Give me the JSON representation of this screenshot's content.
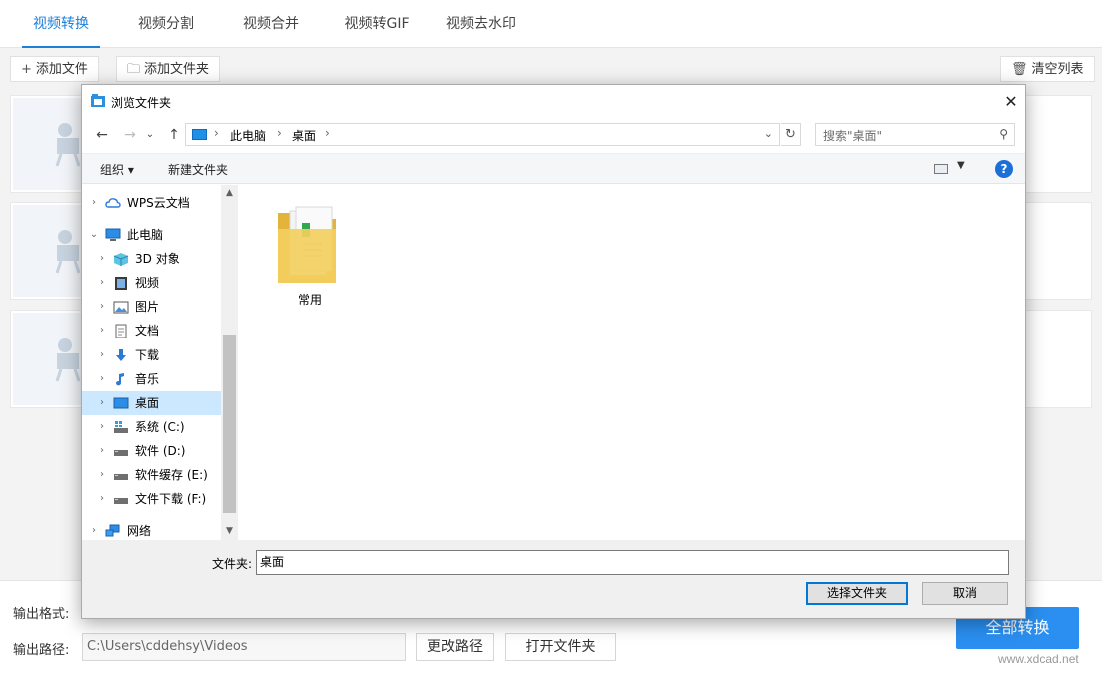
{
  "app": {
    "tabs": [
      "视频转换",
      "视频分割",
      "视频合并",
      "视频转GIF",
      "视频去水印"
    ],
    "active_tab": 0,
    "toolbar": {
      "add_file": "添加文件",
      "add_folder": "添加文件夹",
      "clear_list": "清空列表"
    },
    "bottom": {
      "output_format_label": "输出格式:",
      "output_path_label": "输出路径:",
      "output_path_value": "C:\\Users\\cddehsy\\Videos",
      "change_path": "更改路径",
      "open_folder": "打开文件夹",
      "convert_all": "全部转换"
    },
    "watermark": "www.xdcad.net",
    "accent_color": "#1d7fd8"
  },
  "dialog": {
    "title": "浏览文件夹",
    "breadcrumb": [
      "此电脑",
      "桌面"
    ],
    "search_placeholder": "搜索\"桌面\"",
    "commands": {
      "organize": "组织 ▾",
      "new_folder": "新建文件夹"
    },
    "tree": [
      {
        "label": "WPS云文档",
        "icon": "cloud-icon",
        "level": 0,
        "expander": "›"
      },
      {
        "label": "此电脑",
        "icon": "computer-icon",
        "level": 0,
        "expander": "⌄"
      },
      {
        "label": "3D 对象",
        "icon": "3d-objects-icon",
        "level": 1,
        "expander": "›"
      },
      {
        "label": "视频",
        "icon": "video-folder-icon",
        "level": 1,
        "expander": "›"
      },
      {
        "label": "图片",
        "icon": "pictures-folder-icon",
        "level": 1,
        "expander": "›"
      },
      {
        "label": "文档",
        "icon": "documents-folder-icon",
        "level": 1,
        "expander": "›"
      },
      {
        "label": "下载",
        "icon": "download-folder-icon",
        "level": 1,
        "expander": "›"
      },
      {
        "label": "音乐",
        "icon": "music-folder-icon",
        "level": 1,
        "expander": "›"
      },
      {
        "label": "桌面",
        "icon": "desktop-folder-icon",
        "level": 1,
        "expander": "›",
        "selected": true
      },
      {
        "label": "系统 (C:)",
        "icon": "system-drive-icon",
        "level": 1,
        "expander": "›"
      },
      {
        "label": "软件 (D:)",
        "icon": "drive-icon",
        "level": 1,
        "expander": "›"
      },
      {
        "label": "软件缓存 (E:)",
        "icon": "drive-icon",
        "level": 1,
        "expander": "›"
      },
      {
        "label": "文件下载 (F:)",
        "icon": "drive-icon",
        "level": 1,
        "expander": "›"
      },
      {
        "label": "网络",
        "icon": "network-icon",
        "level": 0,
        "expander": "›"
      }
    ],
    "items": [
      {
        "label": "常用",
        "icon": "folder-icon"
      }
    ],
    "folder_label": "文件夹:",
    "folder_value": "桌面",
    "select_button": "选择文件夹",
    "cancel_button": "取消"
  }
}
